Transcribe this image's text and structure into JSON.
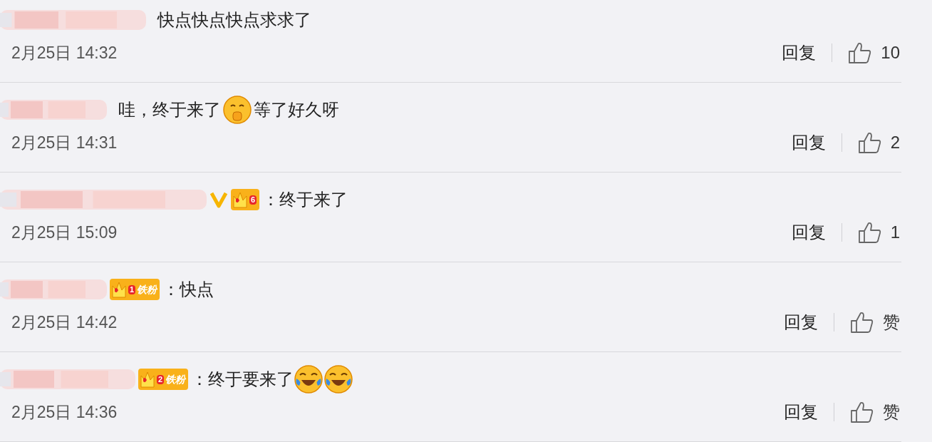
{
  "comments": [
    {
      "vip": false,
      "content": [
        {
          "kind": "text",
          "text": "快点快点快点求求了"
        }
      ],
      "time": "2月25日 14:32",
      "reply": "回复",
      "likes": "10"
    },
    {
      "vip": false,
      "content": [
        {
          "kind": "text",
          "text": "哇，终于来了"
        },
        {
          "kind": "shush-emoji"
        },
        {
          "kind": "text",
          "text": "等了好久呀"
        }
      ],
      "time": "2月25日 14:31",
      "reply": "回复",
      "likes": "2"
    },
    {
      "vip": true,
      "badge": {
        "level": "6"
      },
      "content": [
        {
          "kind": "text",
          "text": "：终于来了"
        }
      ],
      "time": "2月25日 15:09",
      "reply": "回复",
      "likes": "1"
    },
    {
      "vip": false,
      "badge": {
        "level": "1",
        "label": "铁粉"
      },
      "content": [
        {
          "kind": "text",
          "text": "：快点"
        }
      ],
      "time": "2月25日 14:42",
      "reply": "回复",
      "likes": "赞"
    },
    {
      "vip": false,
      "badge": {
        "level": "2",
        "label": "铁粉"
      },
      "content": [
        {
          "kind": "text",
          "text": "：终于要来了"
        },
        {
          "kind": "laugh-emoji"
        },
        {
          "kind": "laugh-emoji"
        }
      ],
      "time": "2月25日 14:36",
      "reply": "回复",
      "likes": "赞"
    }
  ]
}
